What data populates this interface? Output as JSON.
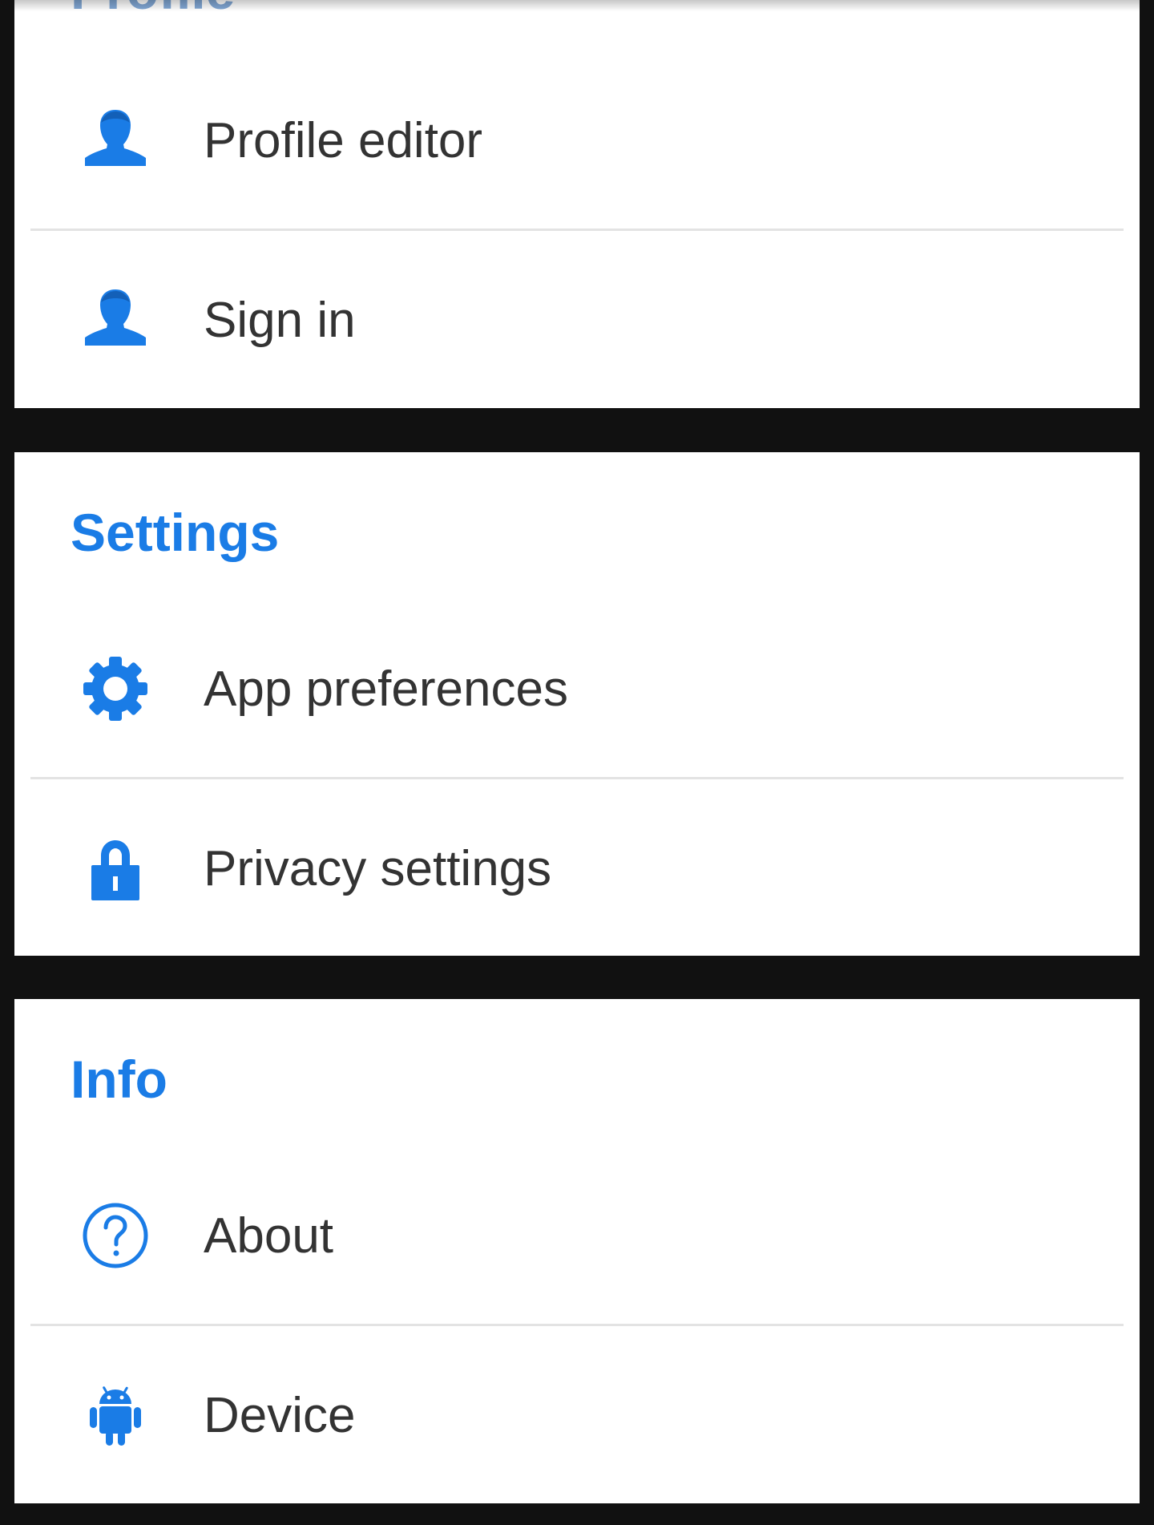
{
  "accent_color": "#1a7ce6",
  "sections": {
    "profile": {
      "title": "Profile",
      "items": [
        {
          "label": "Profile editor",
          "icon": "person-icon"
        },
        {
          "label": "Sign in",
          "icon": "person-icon"
        }
      ]
    },
    "settings": {
      "title": "Settings",
      "items": [
        {
          "label": "App preferences",
          "icon": "gear-icon"
        },
        {
          "label": "Privacy settings",
          "icon": "lock-icon"
        }
      ]
    },
    "info": {
      "title": "Info",
      "items": [
        {
          "label": "About",
          "icon": "help-circle-icon"
        },
        {
          "label": "Device",
          "icon": "android-icon"
        }
      ]
    }
  }
}
